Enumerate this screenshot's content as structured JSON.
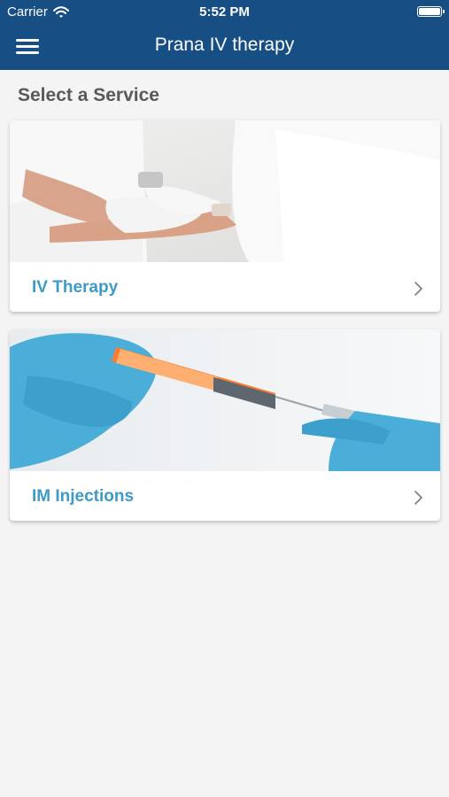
{
  "status_bar": {
    "carrier": "Carrier",
    "time": "5:52 PM",
    "wifi_icon": "wifi-icon",
    "battery_icon": "battery-icon"
  },
  "header": {
    "title": "Prana IV therapy",
    "menu_icon": "hamburger-menu-icon",
    "background_color": "#174f84"
  },
  "main": {
    "section_title": "Select a Service",
    "services": [
      {
        "label": "IV Therapy",
        "image": "iv-therapy-photo",
        "chevron_icon": "chevron-right-icon"
      },
      {
        "label": "IM Injections",
        "image": "im-injection-photo",
        "chevron_icon": "chevron-right-icon"
      }
    ]
  },
  "colors": {
    "accent": "#3f9ac8",
    "page_background": "#f4f4f4"
  }
}
